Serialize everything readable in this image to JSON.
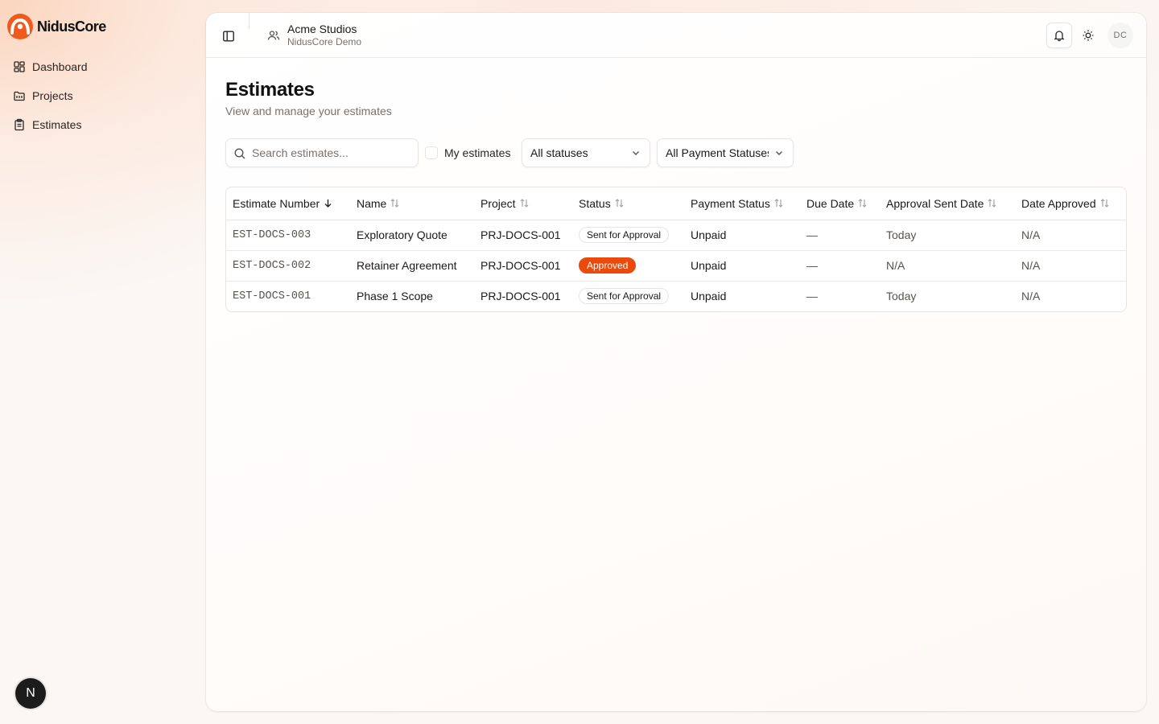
{
  "brand": {
    "name": "NidusCore",
    "color": "#ef5a1e"
  },
  "sidebar": {
    "items": [
      {
        "label": "Dashboard",
        "icon": "dashboard-grid-icon"
      },
      {
        "label": "Projects",
        "icon": "folder-icon"
      },
      {
        "label": "Estimates",
        "icon": "clipboard-icon"
      }
    ],
    "bottom_avatar": "N"
  },
  "topbar": {
    "org_name": "Acme Studios",
    "org_sub": "NidusCore Demo",
    "user_initials": "DC",
    "icons": [
      "panel-left-icon",
      "users-icon",
      "bell-icon",
      "sun-icon"
    ]
  },
  "page": {
    "title": "Estimates",
    "subtitle": "View and manage your estimates"
  },
  "filters": {
    "search_placeholder": "Search estimates...",
    "my_estimates_label": "My estimates",
    "status_value": "All statuses",
    "payment_value": "All Payment Statuses"
  },
  "table": {
    "columns": [
      "Estimate Number",
      "Name",
      "Project",
      "Status",
      "Payment Status",
      "Due Date",
      "Approval Sent Date",
      "Date Approved"
    ],
    "rows": [
      {
        "number": "EST-DOCS-003",
        "name": "Exploratory Quote",
        "project": "PRJ-DOCS-001",
        "status": "Sent for Approval",
        "payment": "Unpaid",
        "due": "—",
        "sent": "Today",
        "approved": "N/A"
      },
      {
        "number": "EST-DOCS-002",
        "name": "Retainer Agreement",
        "project": "PRJ-DOCS-001",
        "status": "Approved",
        "payment": "Unpaid",
        "due": "—",
        "sent": "N/A",
        "approved": "N/A"
      },
      {
        "number": "EST-DOCS-001",
        "name": "Phase 1 Scope",
        "project": "PRJ-DOCS-001",
        "status": "Sent for Approval",
        "payment": "Unpaid",
        "due": "—",
        "sent": "Today",
        "approved": "N/A"
      }
    ]
  },
  "colors": {
    "accent": "#ea4a0c",
    "border": "#e7e5e4",
    "muted_text": "#78716c"
  }
}
